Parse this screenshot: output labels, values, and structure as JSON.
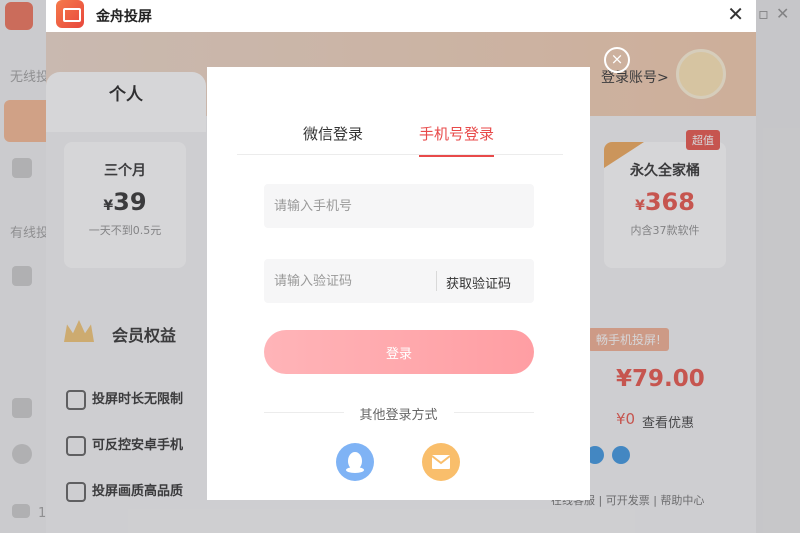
{
  "app": {
    "title": "金舟投屏",
    "close_glyph": "✕"
  },
  "sidebar": {
    "wireless_label": "无线投",
    "wired_label": "有线投",
    "feedback_glyph": "1"
  },
  "background": {
    "tab_personal": "个人",
    "account_link": "登录账号>",
    "plans": [
      {
        "name": "三个月",
        "currency": "¥",
        "price": "39",
        "note": "一天不到0.5元"
      },
      {
        "name": "永久全家桶",
        "currency": "¥",
        "price": "368",
        "note": "内含37款软件",
        "badge": "超值"
      }
    ],
    "benefits_title": "会员权益",
    "benefits": [
      "投屏时长无限制",
      "可反控安卓手机",
      "投屏画质高品质"
    ],
    "promo_tag": "畅手机投屏!",
    "big_price": "¥79.00",
    "zero_price": "¥0",
    "see_deals": "查看优惠",
    "footer_links": "在线客服 | 可开发票 | 帮助中心"
  },
  "login": {
    "tabs": [
      {
        "label": "微信登录",
        "active": false
      },
      {
        "label": "手机号登录",
        "active": true
      }
    ],
    "phone_placeholder": "请输入手机号",
    "code_placeholder": "请输入验证码",
    "get_code_label": "获取验证码",
    "submit_label": "登录",
    "other_methods_label": "其他登录方式",
    "alt_methods": [
      "qq-icon",
      "mail-icon"
    ],
    "close_glyph": "×"
  },
  "colors": {
    "accent_red": "#e84a4a",
    "login_button": "#ff9ea3",
    "qq_blue": "#7fb3f5",
    "mail_orange": "#f9be6b"
  }
}
